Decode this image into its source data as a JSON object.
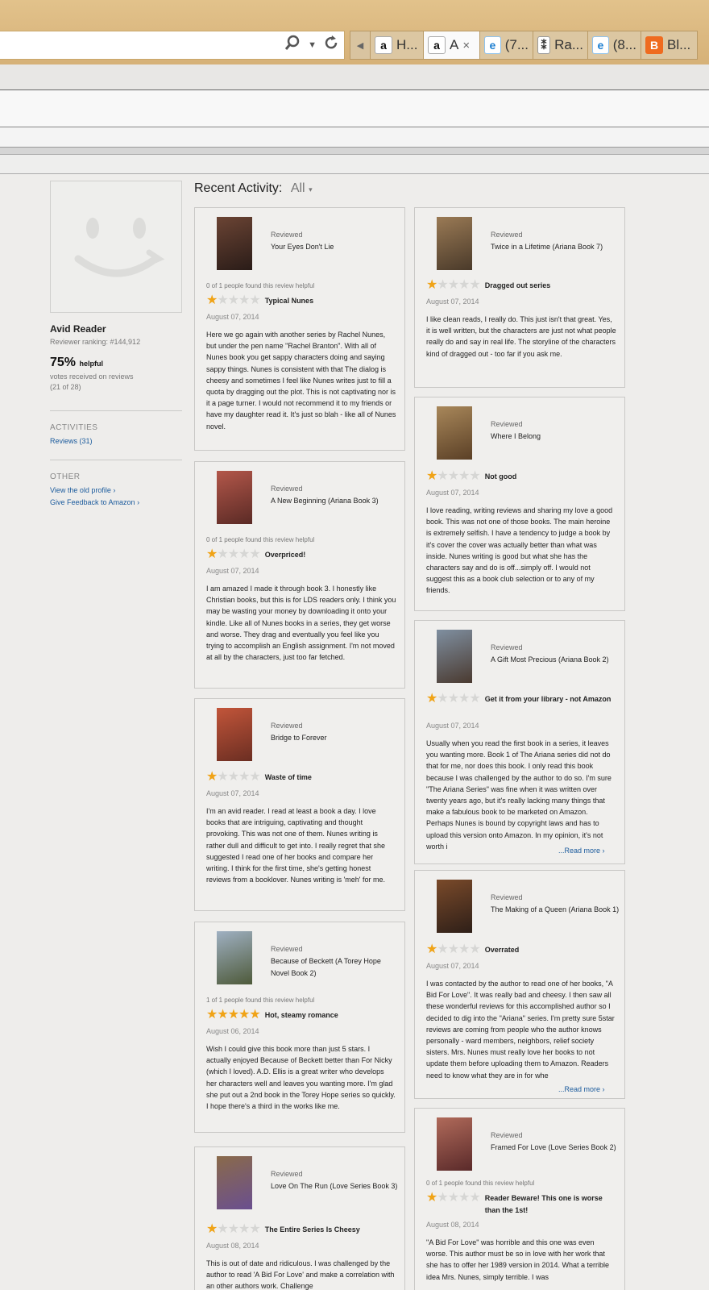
{
  "browser": {
    "tabs": [
      {
        "icon": "amazon-icon",
        "label": "H..."
      },
      {
        "icon": "amazon-icon",
        "label": "A",
        "active": true
      },
      {
        "icon": "ie-icon",
        "label": "(7..."
      },
      {
        "icon": "library-icon",
        "label": "Ra..."
      },
      {
        "icon": "ie-icon",
        "label": "(8..."
      },
      {
        "icon": "blogger-icon",
        "label": "Bl..."
      }
    ],
    "close_glyph": "×"
  },
  "profile": {
    "name": "Avid Reader",
    "ranking": "Reviewer ranking: #144,912",
    "helpful_percent": "75%",
    "helpful_word": "helpful",
    "votes_line": "votes received on reviews",
    "votes_count": "(21 of 28)",
    "activities_title": "ACTIVITIES",
    "reviews_link": "Reviews (31)",
    "other_title": "OTHER",
    "old_profile_link": "View the old profile",
    "feedback_link": "Give Feedback to Amazon"
  },
  "recent": {
    "label": "Recent Activity:",
    "filter": "All"
  },
  "reviewed_label": "Reviewed",
  "read_more": "...Read more",
  "reviews": [
    {
      "book": "Your Eyes Don't Lie",
      "helpful": "0 of 1 people found this review helpful",
      "stars": 1,
      "title": "Typical Nunes",
      "date": "August 07, 2014",
      "cover": [
        "#6b4434",
        "#2a1c18"
      ],
      "body": "Here we go again with another series by Rachel Nunes, but under the pen name \"Rachel Branton\". With all of Nunes book you get sappy characters doing and saying sappy things. Nunes is consistent with that The dialog is cheesy and sometimes I feel like Nunes writes just to fill a quota by dragging out the plot. This is not captivating nor is it a page turner. I would not recommend it to my friends or have my daughter read it. It's just so blah - like all of Nunes novel."
    },
    {
      "book": "A New Beginning (Ariana Book 3)",
      "helpful": "0 of 1 people found this review helpful",
      "stars": 1,
      "title": "Overpriced!",
      "date": "August 07, 2014",
      "cover": [
        "#b3574a",
        "#5a2a25"
      ],
      "body": "I am amazed I made it through book 3. I honestly like Christian books, but this is for LDS readers only. I think you may be wasting your money by downloading it onto your kindle. Like all of Nunes books in a series, they get worse and worse. They drag and eventually you feel like you trying to accomplish an English assignment. I'm not moved at all by the characters, just too far fetched."
    },
    {
      "book": "Bridge to Forever",
      "helpful": "",
      "stars": 1,
      "title": "Waste of time",
      "date": "August 07, 2014",
      "cover": [
        "#c2553a",
        "#6b2e22"
      ],
      "body": "I'm an avid reader. I read at least a book a day. I love books that are intriguing, captivating and thought provoking. This was not one of them. Nunes writing is rather dull and difficult to get into. I really regret that she suggested I read one of her books and compare her writing. I think for the first time, she's getting honest reviews from a booklover. Nunes writing is 'meh' for me."
    },
    {
      "book": "Because of Beckett (A Torey Hope Novel Book 2)",
      "helpful": "1 of 1 people found this review helpful",
      "stars": 5,
      "title": "Hot, steamy romance",
      "date": "August 06, 2014",
      "cover": [
        "#9fb0c2",
        "#4e5a3a"
      ],
      "body": "Wish I could give this book more than just 5 stars. I actually enjoyed Because of Beckett better than For Nicky (which I loved). A.D. Ellis is a great writer who develops her characters well and leaves you wanting more. I'm glad she put out a 2nd book in the Torey Hope series so quickly. I hope there's a third in the works like me."
    },
    {
      "book": "Love On The Run (Love Series Book 3)",
      "helpful": "",
      "stars": 1,
      "title": "The Entire Series Is Cheesy",
      "date": "August 08, 2014",
      "cover": [
        "#8a6a4a",
        "#6a4f8f"
      ],
      "body": "This is out of date and ridiculous. I was challenged by the author to read 'A Bid For Love' and make a correlation with an other authors work. Challenge"
    },
    {
      "book": "Twice in a Lifetime (Ariana Book 7)",
      "helpful": "",
      "stars": 1,
      "title": "Dragged out series",
      "date": "August 07, 2014",
      "cover": [
        "#9a7a55",
        "#4a3a2a"
      ],
      "body": "I like clean reads, I really do. This just isn't that great. Yes, it is well written, but the characters are just not what people really do and say in real life. The storyline of the characters kind of dragged out - too far if you ask me."
    },
    {
      "book": "Where I Belong",
      "helpful": "",
      "stars": 1,
      "title": "Not good",
      "date": "August 07, 2014",
      "cover": [
        "#a8875a",
        "#5b4026"
      ],
      "body": "I love reading, writing reviews and sharing my love a good book. This was not one of those books. The main heroine is extremely selfish. I have a tendency to judge a book by it's cover the cover was actually better than what was inside. Nunes writing is good but what she has the characters say and do is off...simply off. I would not suggest this as a book club selection or to any of my friends."
    },
    {
      "book": "A Gift Most Precious (Ariana Book 2)",
      "helpful": "",
      "stars": 1,
      "title": "Get it from your library - not Amazon",
      "date": "August 07, 2014",
      "cover": [
        "#7f8fa0",
        "#4a3a30"
      ],
      "body": "Usually when you read the first book in a series, it leaves you wanting more. Book 1 of The Ariana series did not do that for me, nor does this book. I only read this book because I was challenged by the author to do so. I'm sure \"The Ariana Series\" was fine when it was written over twenty years ago, but it's really lacking many things that make a fabulous book to be marketed on Amazon. Perhaps Nunes is bound by copyright laws and has to upload this version onto Amazon. In my opinion, it's not worth i"
    },
    {
      "book": "The Making of a Queen (Ariana Book 1)",
      "helpful": "",
      "stars": 1,
      "title": "Overrated",
      "date": "August 07, 2014",
      "cover": [
        "#7a4a2a",
        "#2e1f18"
      ],
      "body": "I was contacted by the author to read one of her books, \"A Bid For Love\". It was really bad and cheesy. I then saw all these wonderful reviews for this accomplished author so I decided to dig into the \"Ariana\" series. I'm pretty sure 5star reviews are coming from people who the author knows personally - ward members, neighbors, relief society sisters. Mrs. Nunes must really love her books to not update them before uploading them to Amazon. Readers need to know what they are in for whe"
    },
    {
      "book": "Framed For Love (Love Series Book 2)",
      "helpful": "0 of 1 people found this review helpful",
      "stars": 1,
      "title": "Reader Beware! This one is worse than the 1st!",
      "date": "August 08, 2014",
      "cover": [
        "#b06a5a",
        "#5a2a2a"
      ],
      "body": "\"A Bid For Love\" was horrible and this one was even worse. This author must be so in love with her work that she has to offer her 1989 version in 2014. What a terrible idea Mrs. Nunes, simply terrible. I was"
    }
  ]
}
